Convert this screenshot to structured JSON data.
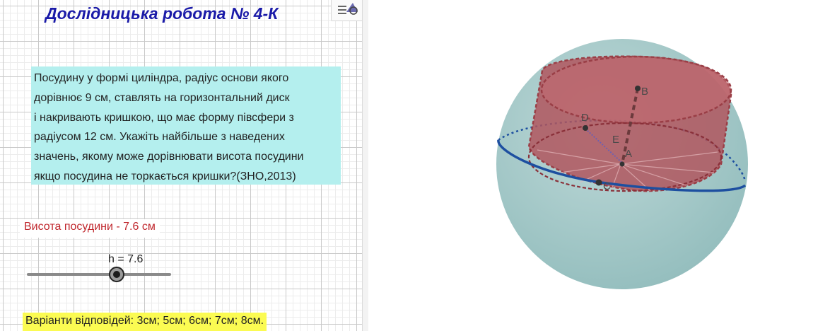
{
  "title": "Дослідницька робота № 4-К",
  "problem_lines": [
    "Посудину у формі циліндра, радіус основи якого",
    "дорівнює 9 см, ставлять на горизонтальний диск",
    "і накривають кришкою, що має форму півсфери з",
    "радіусом 12 см. Укажіть найбільше з наведених",
    "значень, якому може дорівнювати висота посудини",
    "якщо посудина не торкається кришки?(ЗНО,2013)"
  ],
  "height_label": "Висота посудини - 7.6 см",
  "slider": {
    "caption": "h = 7.6",
    "value": 7.6
  },
  "answers": "Варіанти відповідей: 3см; 5см; 6см; 7см; 8см.",
  "points": {
    "B": "B",
    "D": "D",
    "E": "E",
    "A": "A",
    "C": "C"
  },
  "icons": {
    "style_bar": "style-bar-toggle-icon"
  },
  "colors": {
    "title": "#1a1aa8",
    "problem_bg": "#b4efee",
    "height_label": "#c0272d",
    "answers_bg": "#fbfb52",
    "sphere": "#9ec6c6",
    "cylinder": "#b0565e",
    "disk_edge": "#1d4fa0"
  }
}
